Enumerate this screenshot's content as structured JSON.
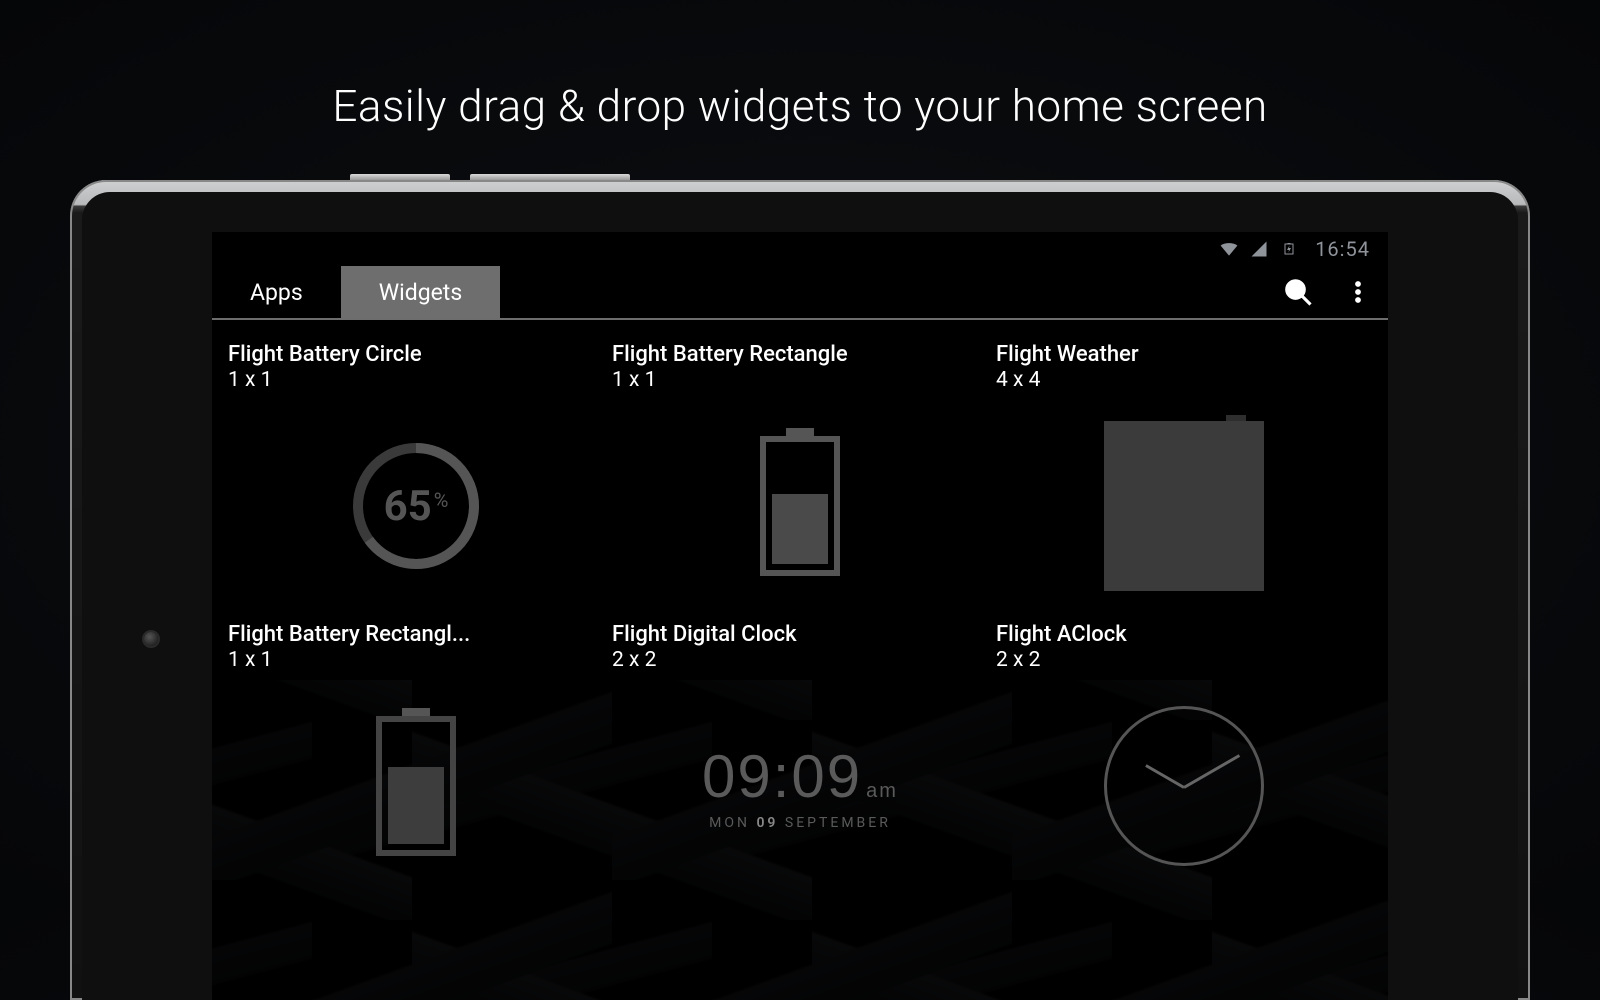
{
  "headline": "Easily drag & drop widgets to your home screen",
  "status": {
    "time": "16:54"
  },
  "tabs": {
    "apps": "Apps",
    "widgets": "Widgets"
  },
  "battery_circle_pct": "65",
  "digital_clock": {
    "time": "09:09",
    "ampm": "am",
    "date_prefix": "MON ",
    "date_bold": "09",
    "date_suffix": " SEPTEMBER"
  },
  "widgets": [
    {
      "title": "Flight Battery Circle",
      "size": "1 x 1"
    },
    {
      "title": "Flight Battery Rectangle",
      "size": "1 x 1"
    },
    {
      "title": "Flight Weather",
      "size": "4 x 4"
    },
    {
      "title": "Flight Battery Rectangl...",
      "size": "1 x 1"
    },
    {
      "title": "Flight Digital Clock",
      "size": "2 x 2"
    },
    {
      "title": "Flight AClock",
      "size": "2 x 2"
    }
  ]
}
